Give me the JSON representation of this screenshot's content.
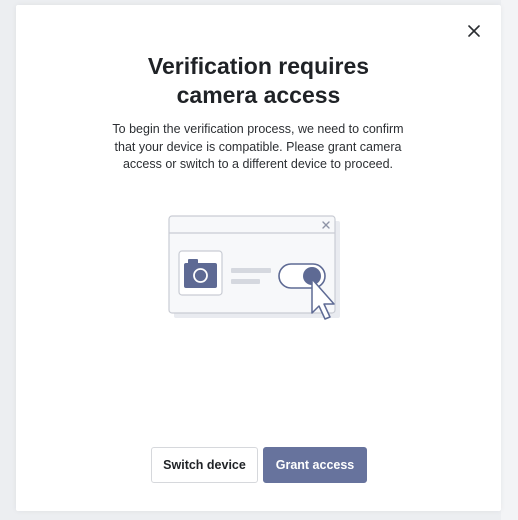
{
  "modal": {
    "title_line1": "Verification requires",
    "title_line2": "camera access",
    "description": "To begin the verification process, we need to confirm that your device is compatible. Please grant camera access or switch to a different device to proceed.",
    "close_icon": "close-icon"
  },
  "illustration": {
    "icons": [
      "browser-window-icon",
      "camera-icon",
      "toggle-icon",
      "cursor-pointer-icon"
    ]
  },
  "actions": {
    "secondary_label": "Switch device",
    "primary_label": "Grant access"
  },
  "colors": {
    "primary": "#67739d",
    "text": "#1f2226",
    "border": "#d6d8dc",
    "backdrop": "#eceef1"
  }
}
